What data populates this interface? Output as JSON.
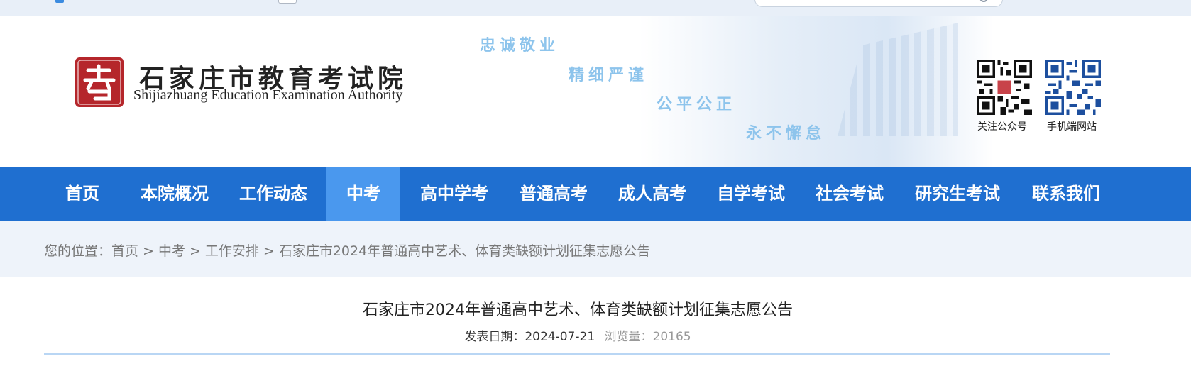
{
  "topbar": {
    "search_placeholder": ""
  },
  "header": {
    "site_name_cn": "石家庄市教育考试院",
    "site_name_en": "Shijiazhuang Education Examination Authority",
    "mottos": [
      "忠诚敬业",
      "精细严谨",
      "公平公正",
      "永不懈怠"
    ],
    "qr_codes": [
      {
        "label": "关注公众号",
        "icon": "qr-code-icon"
      },
      {
        "label": "手机端网站",
        "icon": "qr-code-icon"
      }
    ],
    "logo_icon": "seal-logo-icon"
  },
  "nav": {
    "items": [
      {
        "label": "首页"
      },
      {
        "label": "本院概况"
      },
      {
        "label": "工作动态"
      },
      {
        "label": "中考"
      },
      {
        "label": "高中学考"
      },
      {
        "label": "普通高考"
      },
      {
        "label": "成人高考"
      },
      {
        "label": "自学考试"
      },
      {
        "label": "社会考试"
      },
      {
        "label": "研究生考试"
      },
      {
        "label": "联系我们"
      }
    ],
    "active_index": 3
  },
  "breadcrumb": {
    "prefix": "您的位置：",
    "items": [
      "首页",
      "中考",
      "工作安排",
      "石家庄市2024年普通高中艺术、体育类缺额计划征集志愿公告"
    ],
    "separator": ">"
  },
  "article": {
    "title": "石家庄市2024年普通高中艺术、体育类缺额计划征集志愿公告",
    "date_label": "发表日期：",
    "date_value": "2024-07-21",
    "views_label": "浏览量：",
    "views_value": "20165"
  },
  "colors": {
    "nav_bg": "#1f6fd0",
    "nav_active": "#4a98ee",
    "motto": "#8dc4ec",
    "crumb_bg": "#eef3fa",
    "divider": "#b9d6f4",
    "seal_red": "#b5262b"
  }
}
